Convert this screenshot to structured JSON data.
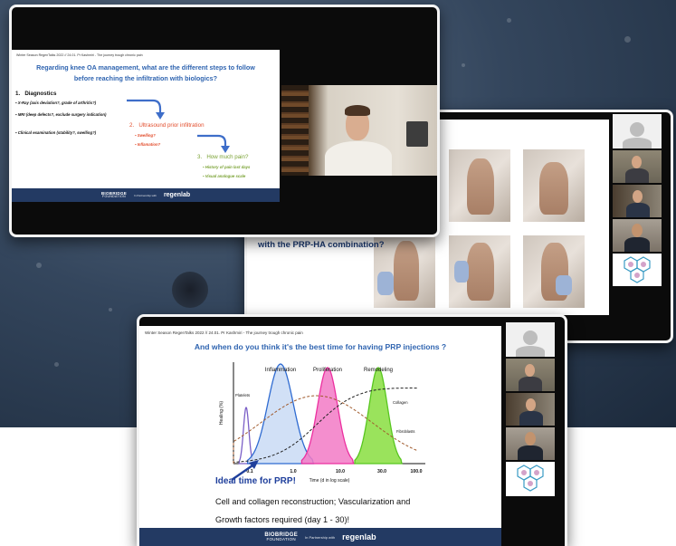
{
  "slide1": {
    "header": "Winter Season RegenTalks 2022 // 24.01. Pr Kashmiri - The journey trough chronic pain",
    "title_line1": "Regarding knee OA management, what are the different steps to follow",
    "title_line2": "before reaching the infiltration with biologics?",
    "step1": {
      "heading": "1.   Diagnostics",
      "bullets": [
        "X-Ray (axis deviation?, grade of arthritis?)",
        "MRI (deep defects?, exclude surgery indication)",
        "Clinical examination (stability?, swelling?)"
      ]
    },
    "step2": {
      "heading": "2.   Ultrasound prior infiltration",
      "bullets": [
        "Swelling?",
        "Inflamation?"
      ]
    },
    "step3": {
      "heading": "3.   How much pain?",
      "bullets": [
        "History of pain last days",
        "Visual analogue scale"
      ]
    }
  },
  "slide2": {
    "caption": "with the PRP-HA combination?"
  },
  "slide3": {
    "header": "Winter Season RegenTalks 2022 // 24.01. Pr Kashmiri - The journey trough chronic pain",
    "title": "And when do you think it's the best time for having PRP injections ?",
    "ideal": "Ideal time for PRP!",
    "body_line1": "Cell and collagen reconstruction; Vascularization and",
    "body_line2": "Growth factors required (day 1 - 30)!",
    "chart_data": {
      "type": "area",
      "ylabel": "Healing (%)",
      "xlabel": "Time (d in log scale)",
      "x_ticks": [
        "0.1",
        "1.0",
        "10.0",
        "30.0",
        "100.0"
      ],
      "phases": [
        "Inflammation",
        "Proliferation",
        "Remodeling"
      ],
      "curve_labels": [
        "Platelets",
        "Collagen",
        "Fibroblasts"
      ],
      "colors": {
        "platelets": "#7b5fc7",
        "inflammation": "#2f6bd1",
        "proliferation": "#ec2f9f",
        "remodeling": "#58c61f",
        "collagen": "#222222",
        "fibroblasts": "#a05a2c"
      }
    }
  },
  "footer": {
    "logo_top": "BIOBRIDGE",
    "logo_bottom": "FOUNDATION",
    "partner": "In Partnership with",
    "brand": "regenlab"
  },
  "colors": {
    "title_blue": "#2f64b0",
    "step2": "#e24c2b",
    "step3": "#7aa234",
    "footer": "#233a63",
    "ideal": "#1f3f9c"
  }
}
